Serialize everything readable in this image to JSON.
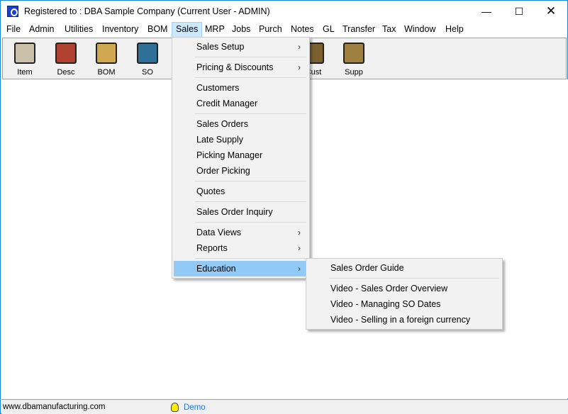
{
  "window": {
    "title": "Registered to : DBA Sample Company (Current User - ADMIN)",
    "controls": [
      "minimize",
      "maximize",
      "close"
    ]
  },
  "menubar": [
    {
      "label": "File"
    },
    {
      "label": "Admin"
    },
    {
      "label": "Utilities"
    },
    {
      "label": "Inventory"
    },
    {
      "label": "BOM"
    },
    {
      "label": "Sales",
      "active": true
    },
    {
      "label": "MRP"
    },
    {
      "label": "Jobs"
    },
    {
      "label": "Purch"
    },
    {
      "label": "Notes"
    },
    {
      "label": "GL"
    },
    {
      "label": "Transfer"
    },
    {
      "label": "Tax"
    },
    {
      "label": "Window"
    },
    {
      "label": "Help"
    }
  ],
  "toolbar": [
    {
      "label": "Item",
      "icon": "item-box-icon"
    },
    {
      "label": "Desc",
      "icon": "desc-person-icon"
    },
    {
      "label": "BOM",
      "icon": "bom-folder-icon"
    },
    {
      "label": "SO",
      "icon": "so-notebook-icon"
    },
    {
      "label": "Cust",
      "icon": "cust-folder-icon"
    },
    {
      "label": "Supp",
      "icon": "supp-folder-icon"
    }
  ],
  "sales_menu": [
    {
      "label": "Sales Setup",
      "submenu": true
    },
    {
      "sep": true
    },
    {
      "label": "Pricing & Discounts",
      "submenu": true
    },
    {
      "sep": true
    },
    {
      "label": "Customers"
    },
    {
      "label": "Credit Manager"
    },
    {
      "sep": true
    },
    {
      "label": "Sales Orders"
    },
    {
      "label": "Late Supply"
    },
    {
      "label": "Picking Manager"
    },
    {
      "label": "Order Picking"
    },
    {
      "sep": true
    },
    {
      "label": "Quotes"
    },
    {
      "sep": true
    },
    {
      "label": "Sales Order Inquiry"
    },
    {
      "sep": true
    },
    {
      "label": "Data Views",
      "submenu": true
    },
    {
      "label": "Reports",
      "submenu": true
    },
    {
      "sep": true
    },
    {
      "label": "Education",
      "submenu": true,
      "highlighted": true
    }
  ],
  "education_menu": [
    {
      "label": "Sales Order Guide"
    },
    {
      "sep": true
    },
    {
      "label": "Video - Sales Order Overview"
    },
    {
      "label": "Video - Managing SO Dates"
    },
    {
      "label": "Video - Selling in a foreign currency"
    }
  ],
  "status": {
    "url": "www.dbamanufacturing.com",
    "mode": "Demo"
  },
  "colors": {
    "highlight": "#91c9f7",
    "active_menu": "#cce8ff",
    "status_link": "#1e78e6",
    "border": "#1883d7"
  }
}
